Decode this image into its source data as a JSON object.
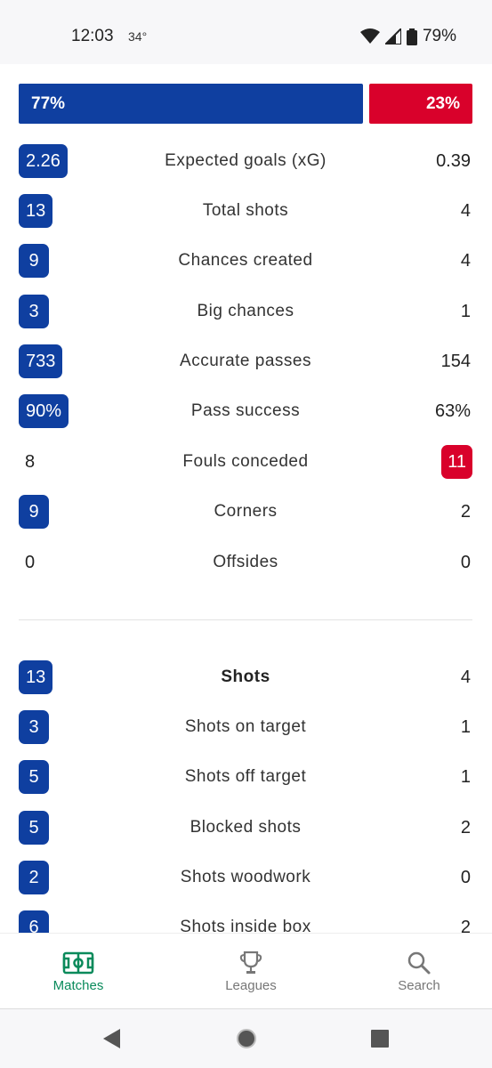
{
  "status": {
    "time": "12:03",
    "temp": "34°",
    "battery": "79%"
  },
  "possession": {
    "home": "77%",
    "away": "23%",
    "home_fraction": 0.77
  },
  "top_stats": [
    {
      "label": "Expected goals (xG)",
      "home": "2.26",
      "away": "0.39",
      "highlight": "home"
    },
    {
      "label": "Total shots",
      "home": "13",
      "away": "4",
      "highlight": "home"
    },
    {
      "label": "Chances created",
      "home": "9",
      "away": "4",
      "highlight": "home"
    },
    {
      "label": "Big chances",
      "home": "3",
      "away": "1",
      "highlight": "home"
    },
    {
      "label": "Accurate passes",
      "home": "733",
      "away": "154",
      "highlight": "home"
    },
    {
      "label": "Pass success",
      "home": "90%",
      "away": "63%",
      "highlight": "home"
    },
    {
      "label": "Fouls conceded",
      "home": "8",
      "away": "11",
      "highlight": "away"
    },
    {
      "label": "Corners",
      "home": "9",
      "away": "2",
      "highlight": "home"
    },
    {
      "label": "Offsides",
      "home": "0",
      "away": "0",
      "highlight": "none"
    }
  ],
  "shots_section": {
    "title": {
      "label": "Shots",
      "home": "13",
      "away": "4"
    },
    "stats": [
      {
        "label": "Shots on target",
        "home": "3",
        "away": "1",
        "highlight": "home"
      },
      {
        "label": "Shots off target",
        "home": "5",
        "away": "1",
        "highlight": "home"
      },
      {
        "label": "Blocked shots",
        "home": "5",
        "away": "2",
        "highlight": "home"
      },
      {
        "label": "Shots woodwork",
        "home": "2",
        "away": "0",
        "highlight": "home"
      },
      {
        "label": "Shots inside box",
        "home": "6",
        "away": "2",
        "highlight": "home"
      }
    ]
  },
  "bottom_nav": {
    "matches": "Matches",
    "leagues": "Leagues",
    "search": "Search"
  },
  "colors": {
    "home": "#0f3fa0",
    "away": "#d9012b",
    "active_nav": "#0a8a5b"
  }
}
